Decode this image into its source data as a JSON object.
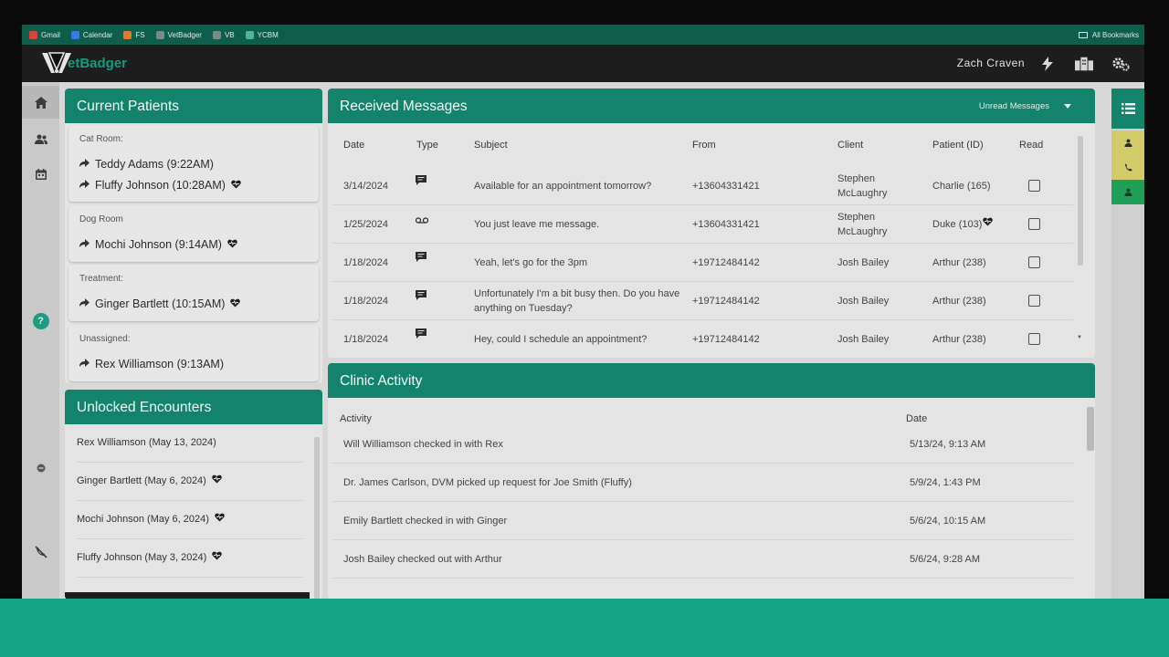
{
  "bookmarks": {
    "items": [
      {
        "label": "Gmail",
        "color": "#d6453b"
      },
      {
        "label": "Calendar",
        "color": "#3a7be0"
      },
      {
        "label": "FS",
        "color": "#e07a2c"
      },
      {
        "label": "VetBadger",
        "color": "#7a8b86"
      },
      {
        "label": "VB",
        "color": "#7a8b86"
      },
      {
        "label": "YCBM",
        "color": "#4fb39a"
      }
    ],
    "all_label": "All Bookmarks"
  },
  "header": {
    "logo_text": "etBadger",
    "user_name": "Zach Craven"
  },
  "current_patients": {
    "title": "Current Patients",
    "rooms": [
      {
        "name": "Cat Room:",
        "patients": [
          {
            "label": "Teddy Adams (9:22AM)",
            "heart": false
          },
          {
            "label": "Fluffy Johnson (10:28AM)",
            "heart": true
          }
        ]
      },
      {
        "name": "Dog Room",
        "patients": [
          {
            "label": "Mochi Johnson (9:14AM)",
            "heart": true
          }
        ]
      },
      {
        "name": "Treatment:",
        "patients": [
          {
            "label": "Ginger Bartlett (10:15AM)",
            "heart": true
          }
        ]
      },
      {
        "name": "Unassigned:",
        "patients": [
          {
            "label": "Rex Williamson (9:13AM)",
            "heart": false
          }
        ]
      }
    ]
  },
  "unlocked_encounters": {
    "title": "Unlocked Encounters",
    "items": [
      {
        "label": "Rex Williamson (May 13, 2024)",
        "heart": false
      },
      {
        "label": "Ginger Bartlett (May 6, 2024)",
        "heart": true
      },
      {
        "label": "Mochi Johnson (May 6, 2024)",
        "heart": true
      },
      {
        "label": "Fluffy Johnson (May 3, 2024)",
        "heart": true
      }
    ]
  },
  "messages": {
    "title": "Received Messages",
    "filter_label": "Unread Messages",
    "columns": [
      "Date",
      "Type",
      "Subject",
      "From",
      "Client",
      "Patient (ID)",
      "Read"
    ],
    "rows": [
      {
        "date": "3/14/2024",
        "type": "sms",
        "subject": "Available for an appointment tomorrow?",
        "from": "+13604331421",
        "client": "Stephen McLaughry",
        "patient": "Charlie (165)",
        "heart": false
      },
      {
        "date": "1/25/2024",
        "type": "voicemail",
        "subject": "You just leave me message.",
        "from": "+13604331421",
        "client": "Stephen McLaughry",
        "patient": "Duke (103)",
        "heart": true
      },
      {
        "date": "1/18/2024",
        "type": "sms",
        "subject": "Yeah, let's go for the 3pm",
        "from": "+19712484142",
        "client": "Josh Bailey",
        "patient": "Arthur (238)",
        "heart": false
      },
      {
        "date": "1/18/2024",
        "type": "sms",
        "subject": "Unfortunately I'm a bit busy then. Do you have anything on Tuesday?",
        "from": "+19712484142",
        "client": "Josh Bailey",
        "patient": "Arthur (238)",
        "heart": false
      },
      {
        "date": "1/18/2024",
        "type": "sms",
        "subject": "Hey, could I schedule an appointment?",
        "from": "+19712484142",
        "client": "Josh Bailey",
        "patient": "Arthur (238)",
        "heart": false
      }
    ]
  },
  "activity": {
    "title": "Clinic Activity",
    "columns": [
      "Activity",
      "Date"
    ],
    "rows": [
      {
        "activity": "Will Williamson checked in with Rex",
        "date": "5/13/24, 9:13 AM"
      },
      {
        "activity": "Dr. James Carlson, DVM picked up request for Joe Smith (Fluffy)",
        "date": "5/9/24, 1:43 PM"
      },
      {
        "activity": "Emily Bartlett checked in with Ginger",
        "date": "5/6/24, 10:15 AM"
      },
      {
        "activity": "Josh Bailey checked out with Arthur",
        "date": "5/6/24, 9:28 AM"
      }
    ]
  },
  "nav": {
    "help_label": "?"
  },
  "colors": {
    "brand": "#13846b",
    "app_bar": "#1d1d1d",
    "yellow_status": "#d3cb6a",
    "green_status": "#1f9f57"
  }
}
